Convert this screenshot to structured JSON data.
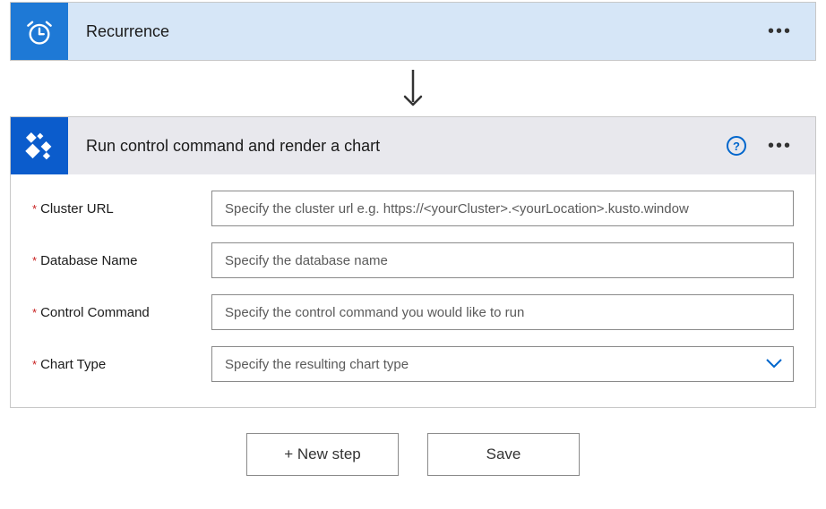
{
  "trigger": {
    "title": "Recurrence"
  },
  "action": {
    "title": "Run control command and render a chart",
    "fields": {
      "cluster_url": {
        "label": "Cluster URL",
        "placeholder": "Specify the cluster url e.g. https://<yourCluster>.<yourLocation>.kusto.window"
      },
      "database_name": {
        "label": "Database Name",
        "placeholder": "Specify the database name"
      },
      "control_command": {
        "label": "Control Command",
        "placeholder": "Specify the control command you would like to run"
      },
      "chart_type": {
        "label": "Chart Type",
        "placeholder": "Specify the resulting chart type"
      }
    }
  },
  "footer": {
    "new_step_label": "+ New step",
    "save_label": "Save"
  }
}
